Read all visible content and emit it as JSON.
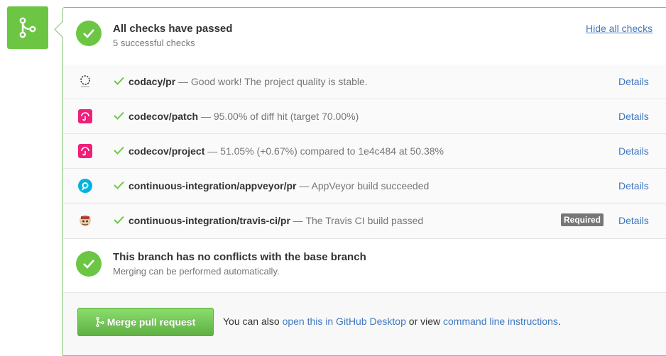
{
  "header": {
    "title": "All checks have passed",
    "subtitle": "5 successful checks",
    "hide_link": "Hide all checks"
  },
  "checks": [
    {
      "avatar": "codacy-logo",
      "context": "codacy/pr",
      "separator": " — ",
      "description": "Good work! The project quality is stable.",
      "details": "Details",
      "badge": ""
    },
    {
      "avatar": "codecov-logo",
      "context": "codecov/patch",
      "separator": " — ",
      "description": "95.00% of diff hit (target 70.00%)",
      "details": "Details",
      "badge": ""
    },
    {
      "avatar": "codecov-logo",
      "context": "codecov/project",
      "separator": " — ",
      "description": "51.05% (+0.67%) compared to 1e4c484 at 50.38%",
      "details": "Details",
      "badge": ""
    },
    {
      "avatar": "appveyor-logo",
      "context": "continuous-integration/appveyor/pr",
      "separator": " — ",
      "description": "AppVeyor build succeeded",
      "details": "Details",
      "badge": ""
    },
    {
      "avatar": "travis-logo",
      "context": "continuous-integration/travis-ci/pr",
      "separator": " — ",
      "description": "The Travis CI build passed",
      "details": "Details",
      "badge": "Required"
    }
  ],
  "conflict": {
    "title": "This branch has no conflicts with the base branch",
    "subtitle": "Merging can be performed automatically."
  },
  "footer": {
    "merge_button": "Merge pull request",
    "text_before": "You can also ",
    "desktop_link": "open this in GitHub Desktop",
    "text_middle": " or view ",
    "cli_link": "command line instructions",
    "text_after": "."
  },
  "colors": {
    "success": "#6cc644",
    "link": "#4078c0",
    "codecov": "#f01f7a",
    "appveyor": "#00b3e0"
  }
}
